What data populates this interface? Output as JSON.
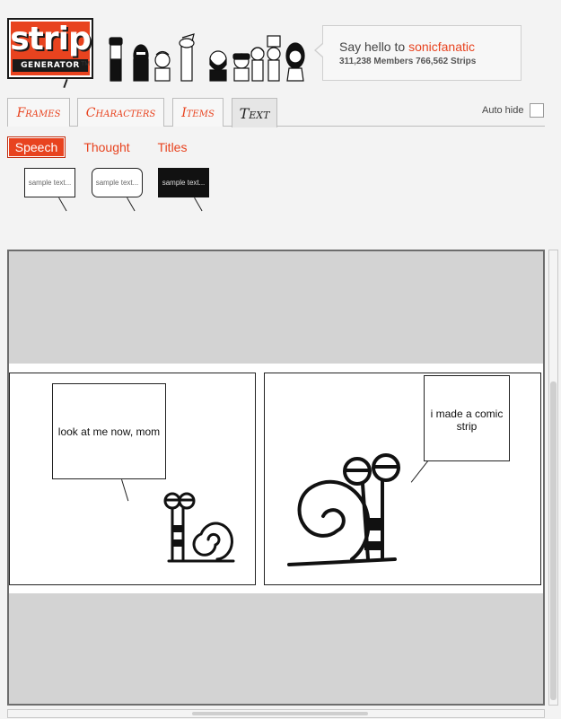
{
  "logo": {
    "main": "strip",
    "sub": "GENERATOR",
    "tm": "TM"
  },
  "greeting": {
    "prefix": "Say hello to",
    "username": "sonicfanatic",
    "members": "311,238",
    "members_label": "Members",
    "strips": "766,562",
    "strips_label": "Strips"
  },
  "tabs": [
    {
      "label": "Frames"
    },
    {
      "label": "Characters"
    },
    {
      "label": "Items"
    },
    {
      "label": "Text"
    }
  ],
  "auto_hide_label": "Auto hide",
  "subtabs": [
    {
      "label": "Speech"
    },
    {
      "label": "Thought"
    },
    {
      "label": "Titles"
    }
  ],
  "samples": [
    {
      "text": "sample text..."
    },
    {
      "text": "sample text..."
    },
    {
      "text": "sample text..."
    }
  ],
  "panels": [
    {
      "bubble": "look at me now, mom"
    },
    {
      "bubble": "i made a comic strip"
    }
  ],
  "colors": {
    "accent": "#e8431f",
    "canvas_gray": "#d3d3d3",
    "bg": "#f3f3f3"
  },
  "icons": {
    "characters_strip": "cartoon-characters-icon",
    "snail": "snail-character-icon"
  }
}
